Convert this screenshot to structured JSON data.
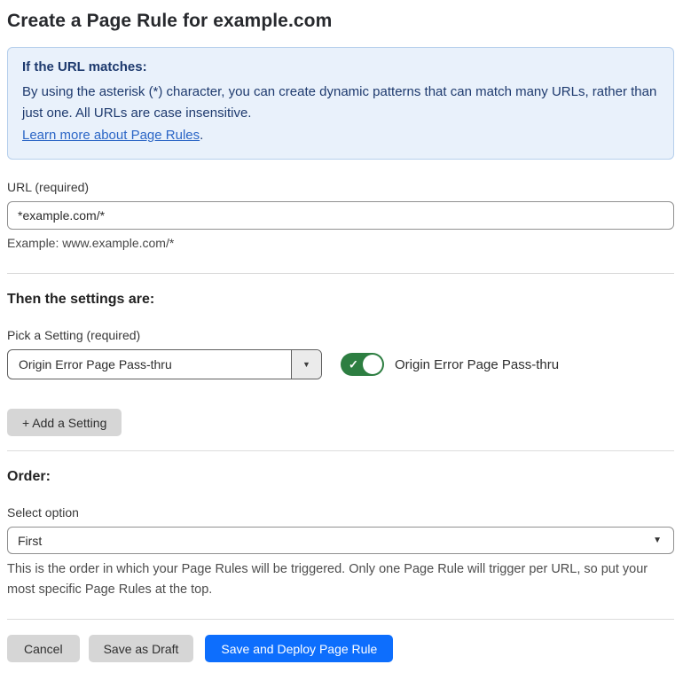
{
  "page": {
    "title": "Create a Page Rule for example.com"
  },
  "info_box": {
    "heading": "If the URL matches:",
    "body": "By using the asterisk (*) character, you can create dynamic patterns that can match many URLs, rather than just one. All URLs are case insensitive.",
    "link_label": "Learn more about Page Rules",
    "link_suffix": "."
  },
  "url_field": {
    "label": "URL (required)",
    "value": "*example.com/*",
    "example": "Example: www.example.com/*"
  },
  "settings_section": {
    "heading": "Then the settings are:",
    "picker_label": "Pick a Setting (required)",
    "picker_value": "Origin Error Page Pass-thru",
    "toggle_label": "Origin Error Page Pass-thru",
    "toggle_state": "on",
    "add_setting_label": "+ Add a Setting"
  },
  "order_section": {
    "heading": "Order:",
    "select_label": "Select option",
    "select_value": "First",
    "help_text": "This is the order in which your Page Rules will be triggered. Only one Page Rule will trigger per URL, so put your most specific Page Rules at the top."
  },
  "footer": {
    "cancel_label": "Cancel",
    "save_draft_label": "Save as Draft",
    "save_deploy_label": "Save and Deploy Page Rule"
  },
  "icons": {
    "caret_down": "▼",
    "check": "✓"
  },
  "colors": {
    "accent_blue": "#0d6efd",
    "toggle_green": "#2d7e41",
    "info_bg": "#e9f1fb",
    "info_border": "#b6cfec",
    "info_text": "#1e3a6e",
    "link_blue": "#2b66c6",
    "button_grey": "#d6d6d6"
  }
}
